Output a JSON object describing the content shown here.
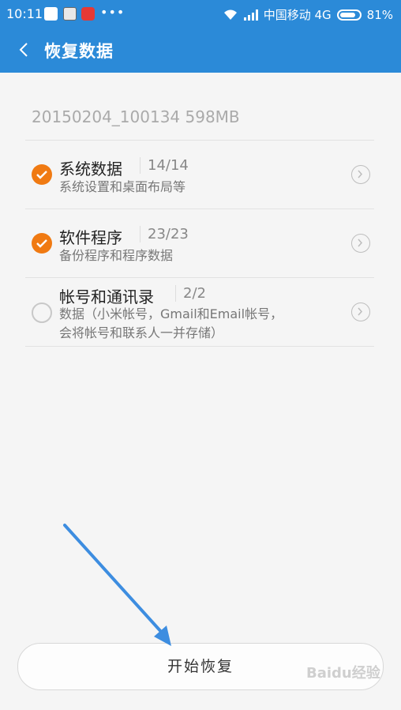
{
  "status_bar": {
    "time": "10:11",
    "carrier": "中国移动 4G",
    "battery": "81%",
    "battery_level": 0.81
  },
  "header": {
    "title": "恢复数据"
  },
  "backup": {
    "info": "20150204_100134   598MB"
  },
  "items": [
    {
      "title": "系统数据",
      "count": "14/14",
      "subtitle": "系统设置和桌面布局等",
      "checked": true
    },
    {
      "title": "软件程序",
      "count": "23/23",
      "subtitle": "备份程序和程序数据",
      "checked": true
    },
    {
      "title": "帐号和通讯录",
      "count": "2/2",
      "subtitle": "数据（小米帐号，Gmail和Email帐号，会将帐号和联系人一并存储）",
      "checked": false
    }
  ],
  "footer": {
    "start_label": "开始恢复"
  },
  "watermark": "Baidu经验",
  "colors": {
    "accent": "#2b8ad8",
    "check": "#f07a12",
    "annotation_arrow": "#3d8de0"
  }
}
